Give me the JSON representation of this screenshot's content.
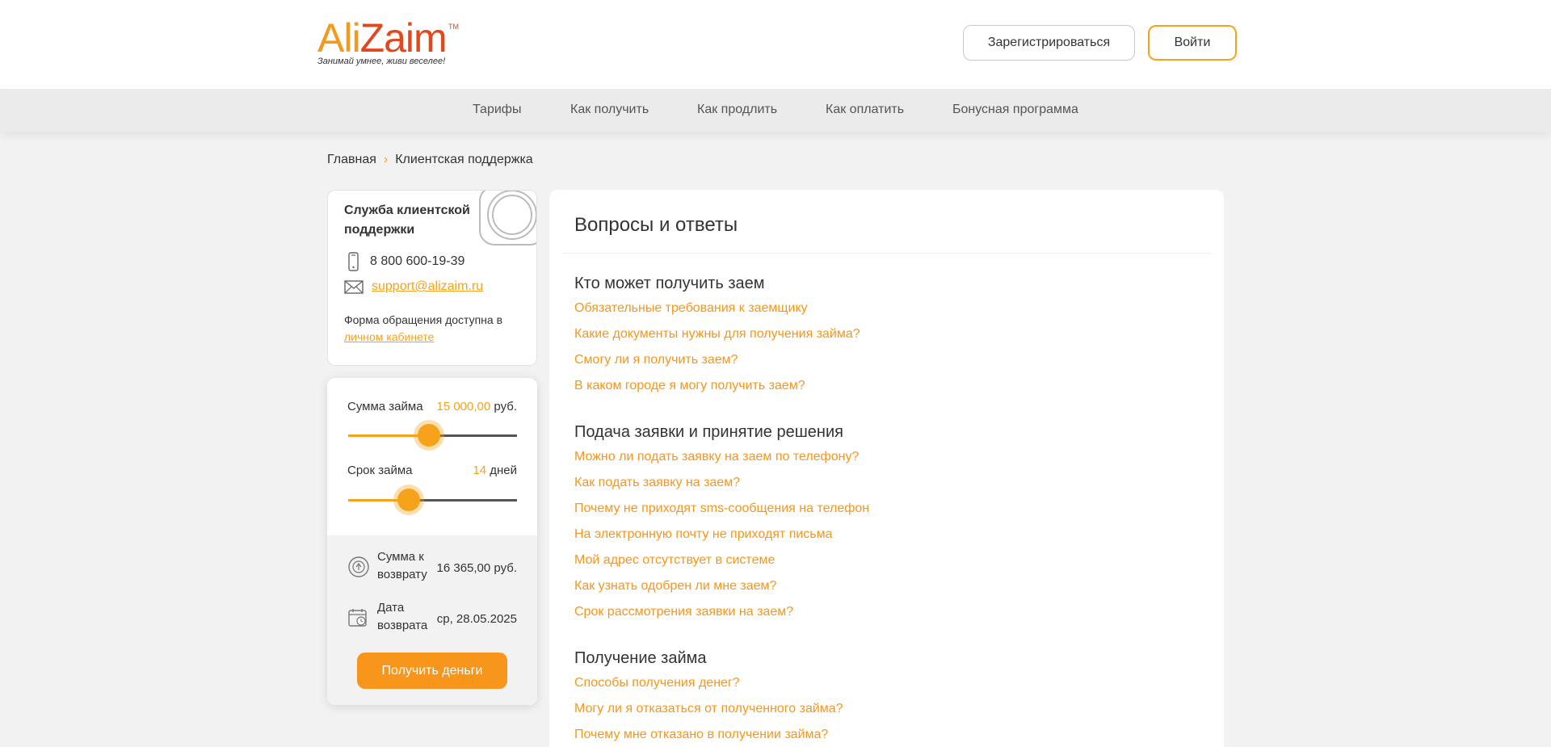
{
  "header": {
    "logo_ali": "Ali",
    "logo_zaim": "Zaim",
    "logo_tm": "TM",
    "slogan": "Занимай умнее, живи веселее!",
    "register_label": "Зарегистрироваться",
    "login_label": "Войти"
  },
  "nav": {
    "items": [
      "Тарифы",
      "Как получить",
      "Как продлить",
      "Как оплатить",
      "Бонусная программа"
    ]
  },
  "breadcrumb": {
    "home": "Главная",
    "separator": "›",
    "current": "Клиентская поддержка"
  },
  "support": {
    "title": "Служба клиентской поддержки",
    "phone": "8 800 600-19-39",
    "email": "support@alizaim.ru",
    "form_text": "Форма обращения доступна в",
    "form_link": "личном кабинете"
  },
  "calculator": {
    "amount_label": "Сумма займа",
    "amount_value": "15 000,00",
    "amount_unit": "руб.",
    "amount_fraction": 0.48,
    "term_label": "Срок займа",
    "term_value": "14",
    "term_unit": "дней",
    "term_fraction": 0.36,
    "return_sum_label": "Сумма к возврату",
    "return_sum_value": "16 365,00 руб.",
    "return_date_label": "Дата возврата",
    "return_date_value": "ср, 28.05.2025",
    "button_label": "Получить деньги"
  },
  "faq": {
    "title": "Вопросы и ответы",
    "sections": [
      {
        "heading": "Кто может получить заем",
        "links": [
          "Обязательные требования к заемщику",
          "Какие документы нужны для получения займа?",
          "Смогу ли я получить заем?",
          "В каком городе я могу получить заем?"
        ]
      },
      {
        "heading": "Подача заявки и принятие решения",
        "links": [
          "Можно ли подать заявку на заем по телефону?",
          "Как подать заявку на заем?",
          "Почему не приходят sms-сообщения на телефон",
          "На электронную почту не приходят письма",
          "Мой адрес отсутствует в системе",
          "Как узнать одобрен ли мне заем?",
          "Срок рассмотрения заявки на заем?"
        ]
      },
      {
        "heading": "Получение займа",
        "links": [
          "Способы получения денег?",
          "Могу ли я отказаться от полученного займа?",
          "Почему мне отказано в получении займа?"
        ]
      }
    ]
  },
  "colors": {
    "accent": "#f7a21b",
    "logo_red": "#e4471b",
    "background": "#f2f2f2"
  }
}
